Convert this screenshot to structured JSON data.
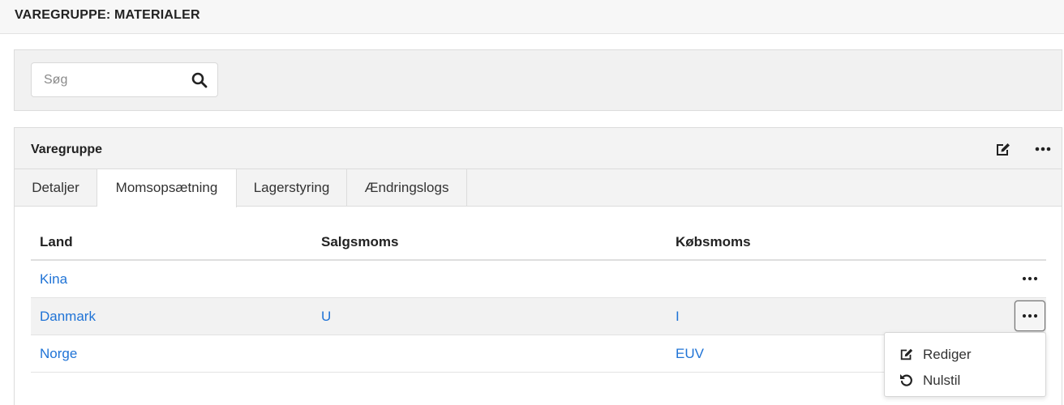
{
  "topbar": {
    "title": "VAREGRUPPE: MATERIALER"
  },
  "search": {
    "placeholder": "Søg",
    "value": "",
    "icon": "search-icon"
  },
  "card": {
    "title": "Varegruppe",
    "actions": {
      "edit_icon": "edit-icon",
      "more_icon": "more-horizontal-icon"
    }
  },
  "tabs": [
    {
      "label": "Detaljer",
      "active": false
    },
    {
      "label": "Momsopsætning",
      "active": true
    },
    {
      "label": "Lagerstyring",
      "active": false
    },
    {
      "label": "Ændringslogs",
      "active": false
    }
  ],
  "table": {
    "columns": [
      "Land",
      "Salgsmoms",
      "Købsmoms"
    ],
    "rows": [
      {
        "land": "Kina",
        "salgsmoms": "",
        "kobsmoms": ""
      },
      {
        "land": "Danmark",
        "salgsmoms": "U",
        "kobsmoms": "I"
      },
      {
        "land": "Norge",
        "salgsmoms": "",
        "kobsmoms": "EUV"
      }
    ]
  },
  "row_menu": {
    "items": [
      {
        "label": "Rediger",
        "icon": "edit-icon"
      },
      {
        "label": "Nulstil",
        "icon": "undo-icon"
      }
    ]
  },
  "colors": {
    "link": "#1f73d6",
    "header_bg": "#f3f3f3",
    "text": "#222222"
  }
}
